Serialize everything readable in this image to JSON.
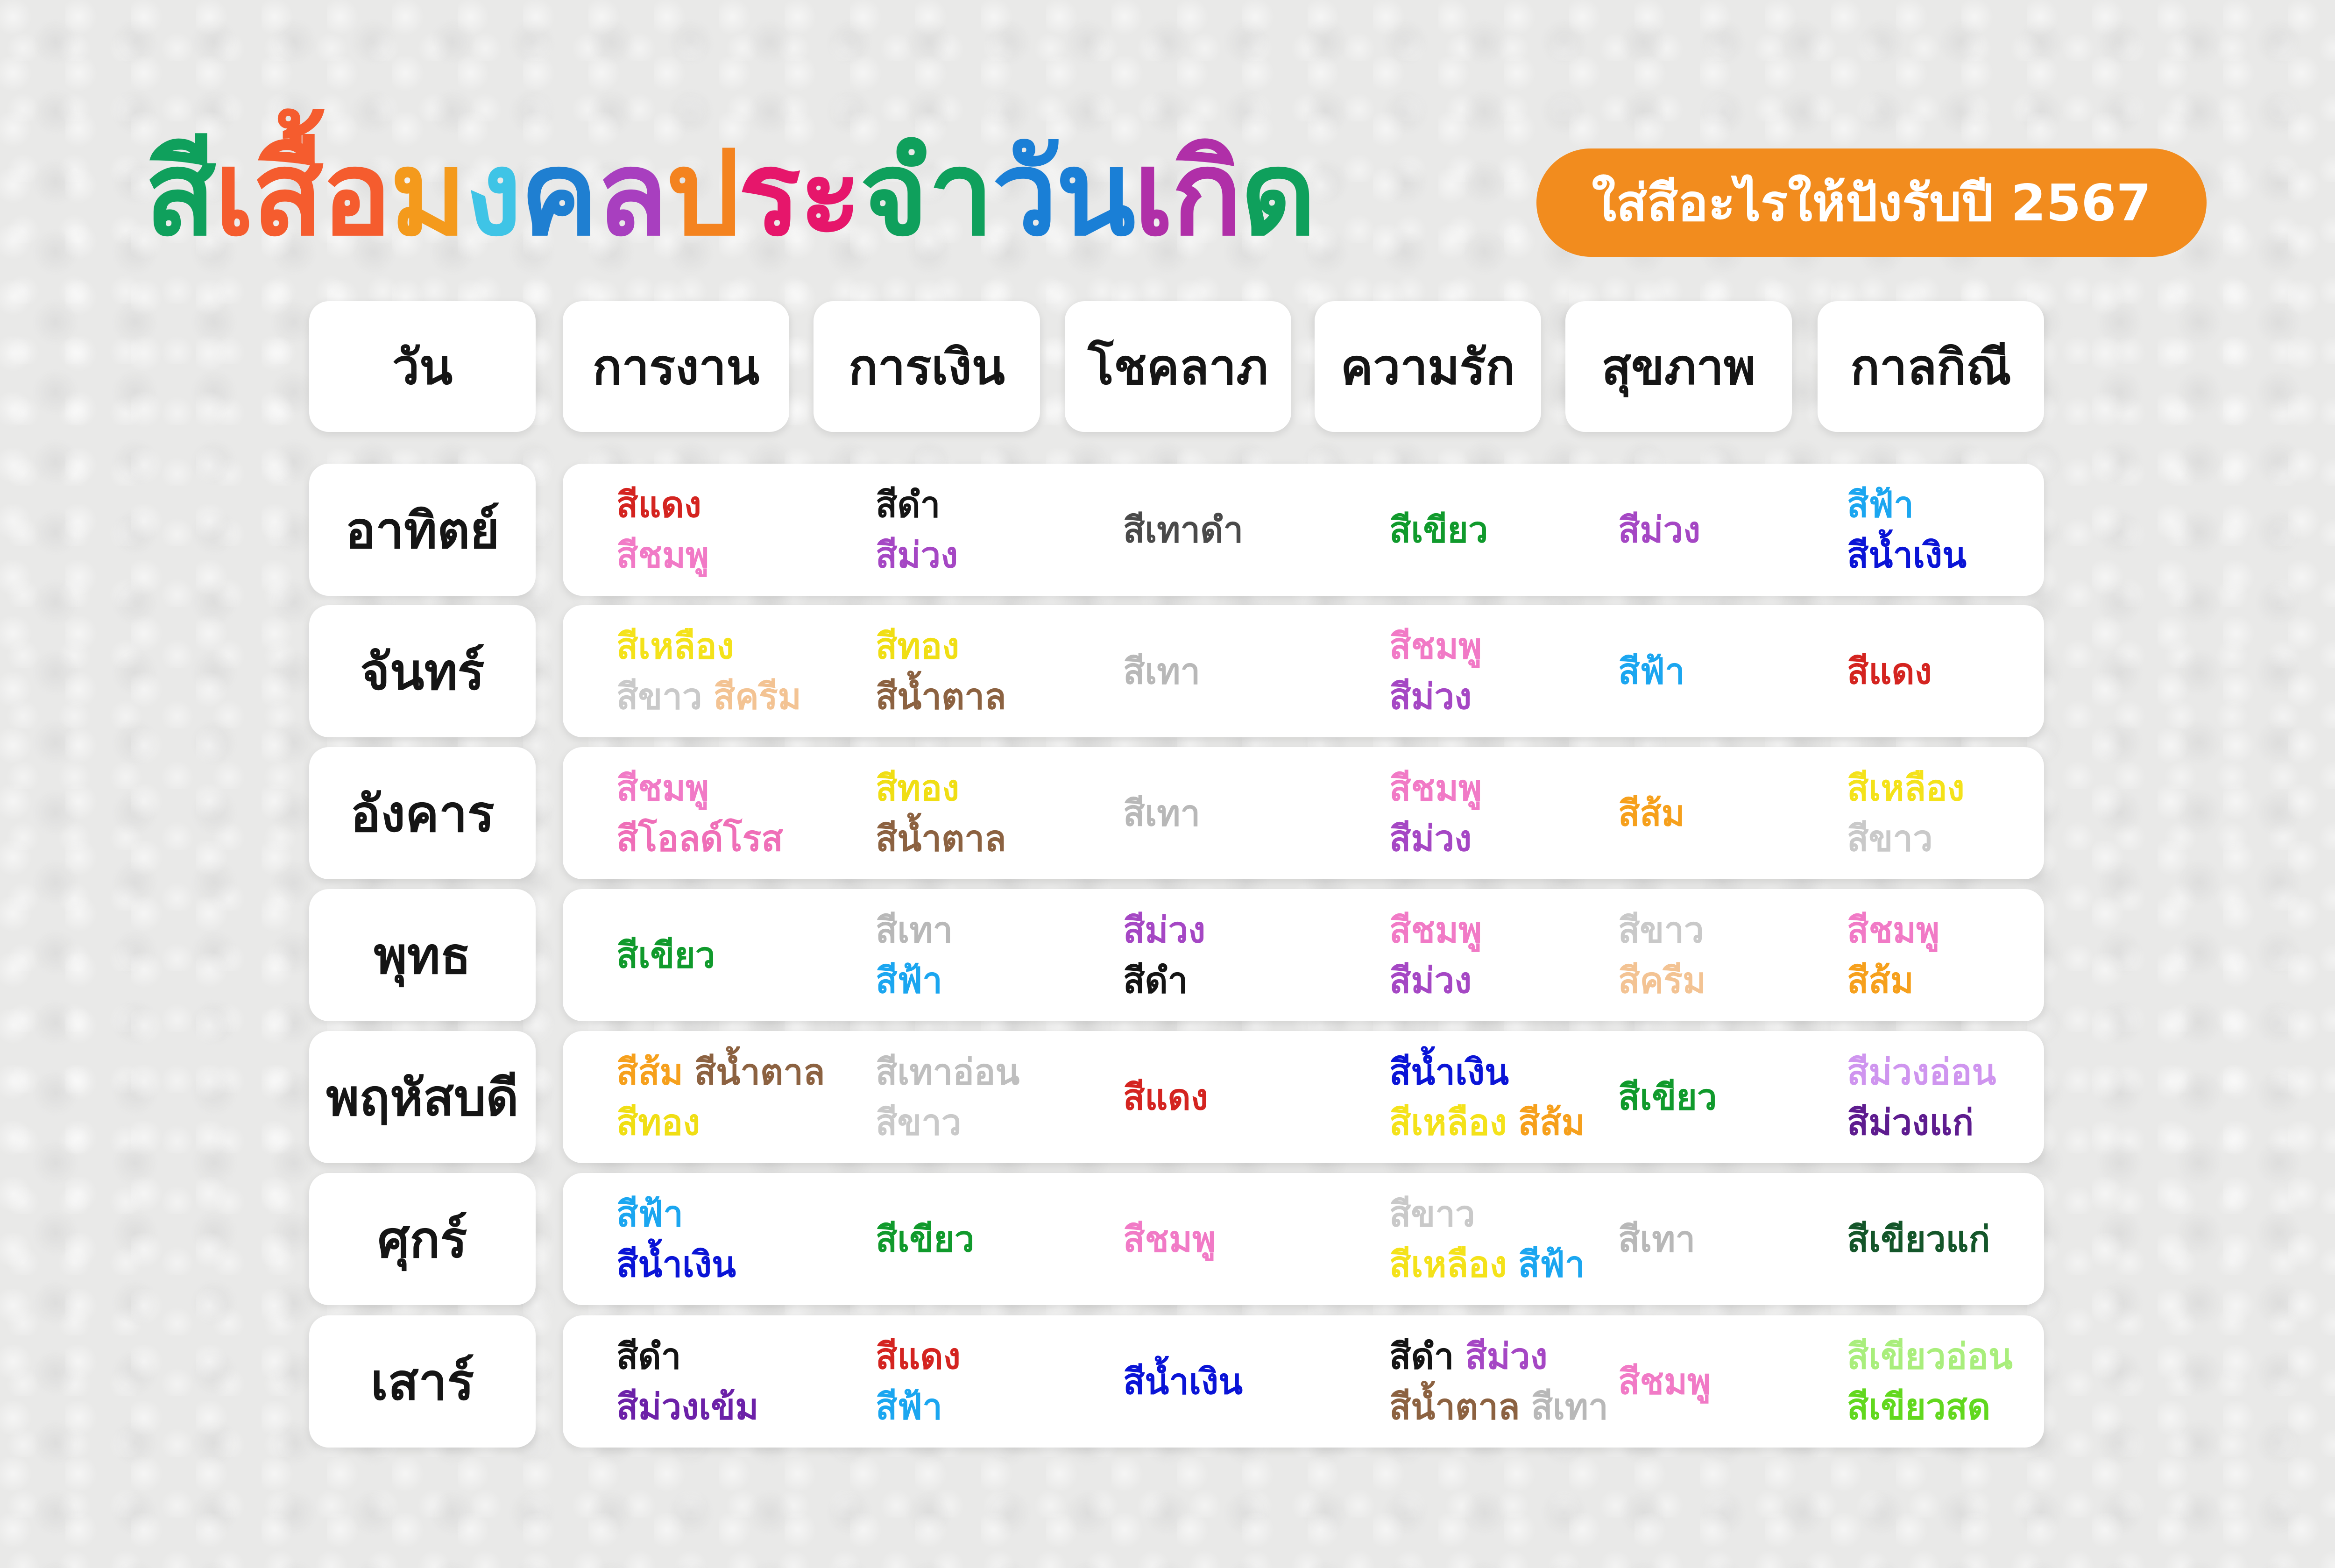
{
  "title": {
    "parts": [
      {
        "text": "สี",
        "color": "#0fa05c"
      },
      {
        "text": "เสื้อ",
        "color": "#f55c2e"
      },
      {
        "text": "ม",
        "color": "#f49a1c"
      },
      {
        "text": "ง",
        "color": "#3fc4e6"
      },
      {
        "text": "ค",
        "color": "#1f7fd1"
      },
      {
        "text": "ล",
        "color": "#a83fbf"
      },
      {
        "text": "ป",
        "color": "#f4831f"
      },
      {
        "text": "ระ",
        "color": "#e6166b"
      },
      {
        "text": "จำ",
        "color": "#0fa05c"
      },
      {
        "text": "วัน",
        "color": "#1a7fd6"
      },
      {
        "text": "เกิ",
        "color": "#b02fa8"
      },
      {
        "text": "ด",
        "color": "#0fa05c"
      }
    ]
  },
  "subtitle": "ใส่สีอะไรให้ปังรับปี 2567",
  "colors": {
    "red": "#d42420",
    "pink": "#f17ac6",
    "black": "#141414",
    "purple": "#a547c4",
    "grayDark": "#4a4a4a",
    "green": "#109a2c",
    "skyBlue": "#1ba6f0",
    "navy": "#0a14d6",
    "yellow": "#f4e21a",
    "white": "#c9c9c9",
    "cream": "#f3c393",
    "gold": "#f0de14",
    "brown": "#8c6241",
    "gray": "#b8b8b8",
    "oldRose": "#ef6fb8",
    "orange": "#f6a01c",
    "lightGray": "#bfbfbf",
    "lightPurple": "#cf95ef",
    "darkPurple": "#5e1c8f",
    "deepPurple": "#6c21a8",
    "darkGreen": "#14562a",
    "lightGreen": "#a9ee7c",
    "brightGreen": "#62d81e"
  },
  "headers": [
    "วัน",
    "การงาน",
    "การเงิน",
    "โชคลาภ",
    "ความรัก",
    "สุขภาพ",
    "กาลกิณี"
  ],
  "rows": [
    {
      "day": "อาทิตย์",
      "cells": [
        [
          [
            {
              "t": "สีแดง",
              "c": "red"
            }
          ],
          [
            {
              "t": "สีชมพู",
              "c": "pink"
            }
          ]
        ],
        [
          [
            {
              "t": "สีดำ",
              "c": "black"
            }
          ],
          [
            {
              "t": "สีม่วง",
              "c": "purple"
            }
          ]
        ],
        [
          [
            {
              "t": "สีเทาดำ",
              "c": "grayDark"
            }
          ]
        ],
        [
          [
            {
              "t": "สีเขียว",
              "c": "green"
            }
          ]
        ],
        [
          [
            {
              "t": "สีม่วง",
              "c": "purple"
            }
          ]
        ],
        [
          [
            {
              "t": "สีฟ้า",
              "c": "skyBlue"
            }
          ],
          [
            {
              "t": "สีน้ำเงิน",
              "c": "navy"
            }
          ]
        ]
      ]
    },
    {
      "day": "จันทร์",
      "cells": [
        [
          [
            {
              "t": "สีเหลือง",
              "c": "yellow"
            }
          ],
          [
            {
              "t": "สีขาว",
              "c": "white"
            },
            {
              "t": "สีครีม",
              "c": "cream"
            }
          ]
        ],
        [
          [
            {
              "t": "สีทอง",
              "c": "gold"
            }
          ],
          [
            {
              "t": "สีน้ำตาล",
              "c": "brown"
            }
          ]
        ],
        [
          [
            {
              "t": "สีเทา",
              "c": "gray"
            }
          ]
        ],
        [
          [
            {
              "t": "สีชมพู",
              "c": "pink"
            }
          ],
          [
            {
              "t": "สีม่วง",
              "c": "purple"
            }
          ]
        ],
        [
          [
            {
              "t": "สีฟ้า",
              "c": "skyBlue"
            }
          ]
        ],
        [
          [
            {
              "t": "สีแดง",
              "c": "red"
            }
          ]
        ]
      ]
    },
    {
      "day": "อังคาร",
      "cells": [
        [
          [
            {
              "t": "สีชมพู",
              "c": "pink"
            }
          ],
          [
            {
              "t": "สีโอลด์โรส",
              "c": "oldRose"
            }
          ]
        ],
        [
          [
            {
              "t": "สีทอง",
              "c": "gold"
            }
          ],
          [
            {
              "t": "สีน้ำตาล",
              "c": "brown"
            }
          ]
        ],
        [
          [
            {
              "t": "สีเทา",
              "c": "gray"
            }
          ]
        ],
        [
          [
            {
              "t": "สีชมพู",
              "c": "pink"
            }
          ],
          [
            {
              "t": "สีม่วง",
              "c": "purple"
            }
          ]
        ],
        [
          [
            {
              "t": "สีส้ม",
              "c": "orange"
            }
          ]
        ],
        [
          [
            {
              "t": "สีเหลือง",
              "c": "yellow"
            }
          ],
          [
            {
              "t": "สีขาว",
              "c": "white"
            }
          ]
        ]
      ]
    },
    {
      "day": "พุทธ",
      "cells": [
        [
          [
            {
              "t": "สีเขียว",
              "c": "green"
            }
          ]
        ],
        [
          [
            {
              "t": "สีเทา",
              "c": "gray"
            }
          ],
          [
            {
              "t": "สีฟ้า",
              "c": "skyBlue"
            }
          ]
        ],
        [
          [
            {
              "t": "สีม่วง",
              "c": "purple"
            }
          ],
          [
            {
              "t": "สีดำ",
              "c": "black"
            }
          ]
        ],
        [
          [
            {
              "t": "สีชมพู",
              "c": "pink"
            }
          ],
          [
            {
              "t": "สีม่วง",
              "c": "purple"
            }
          ]
        ],
        [
          [
            {
              "t": "สีขาว",
              "c": "white"
            }
          ],
          [
            {
              "t": "สีครีม",
              "c": "cream"
            }
          ]
        ],
        [
          [
            {
              "t": "สีชมพู",
              "c": "pink"
            }
          ],
          [
            {
              "t": "สีส้ม",
              "c": "orange"
            }
          ]
        ]
      ]
    },
    {
      "day": "พฤหัสบดี",
      "cells": [
        [
          [
            {
              "t": "สีส้ม",
              "c": "orange"
            },
            {
              "t": "สีน้ำตาล",
              "c": "brown"
            }
          ],
          [
            {
              "t": "สีทอง",
              "c": "gold"
            }
          ]
        ],
        [
          [
            {
              "t": "สีเทาอ่อน",
              "c": "lightGray"
            }
          ],
          [
            {
              "t": "สีขาว",
              "c": "white"
            }
          ]
        ],
        [
          [
            {
              "t": "สีแดง",
              "c": "red"
            }
          ]
        ],
        [
          [
            {
              "t": "สีน้ำเงิน",
              "c": "navy"
            }
          ],
          [
            {
              "t": "สีเหลือง",
              "c": "yellow"
            },
            {
              "t": "สีส้ม",
              "c": "orange"
            }
          ]
        ],
        [
          [
            {
              "t": "สีเขียว",
              "c": "green"
            }
          ]
        ],
        [
          [
            {
              "t": "สีม่วงอ่อน",
              "c": "lightPurple"
            }
          ],
          [
            {
              "t": "สีม่วงแก่",
              "c": "darkPurple"
            }
          ]
        ]
      ]
    },
    {
      "day": "ศุกร์",
      "cells": [
        [
          [
            {
              "t": "สีฟ้า",
              "c": "skyBlue"
            }
          ],
          [
            {
              "t": "สีน้ำเงิน",
              "c": "navy"
            }
          ]
        ],
        [
          [
            {
              "t": "สีเขียว",
              "c": "green"
            }
          ]
        ],
        [
          [
            {
              "t": "สีชมพู",
              "c": "pink"
            }
          ]
        ],
        [
          [
            {
              "t": "สีขาว",
              "c": "white"
            }
          ],
          [
            {
              "t": "สีเหลือง",
              "c": "yellow"
            },
            {
              "t": "สีฟ้า",
              "c": "skyBlue"
            }
          ]
        ],
        [
          [
            {
              "t": "สีเทา",
              "c": "gray"
            }
          ]
        ],
        [
          [
            {
              "t": "สีเขียวแก่",
              "c": "darkGreen"
            }
          ]
        ]
      ]
    },
    {
      "day": "เสาร์",
      "cells": [
        [
          [
            {
              "t": "สีดำ",
              "c": "black"
            }
          ],
          [
            {
              "t": "สีม่วงเข้ม",
              "c": "deepPurple"
            }
          ]
        ],
        [
          [
            {
              "t": "สีแดง",
              "c": "red"
            }
          ],
          [
            {
              "t": "สีฟ้า",
              "c": "skyBlue"
            }
          ]
        ],
        [
          [
            {
              "t": "สีน้ำเงิน",
              "c": "navy"
            }
          ]
        ],
        [
          [
            {
              "t": "สีดำ",
              "c": "black"
            },
            {
              "t": "สีม่วง",
              "c": "purple"
            }
          ],
          [
            {
              "t": "สีน้ำตาล",
              "c": "brown"
            },
            {
              "t": "สีเทา",
              "c": "gray"
            }
          ]
        ],
        [
          [
            {
              "t": "สีชมพู",
              "c": "pink"
            }
          ]
        ],
        [
          [
            {
              "t": "สีเขียวอ่อน",
              "c": "lightGreen"
            }
          ],
          [
            {
              "t": "สีเขียวสด",
              "c": "brightGreen"
            }
          ]
        ]
      ]
    }
  ]
}
